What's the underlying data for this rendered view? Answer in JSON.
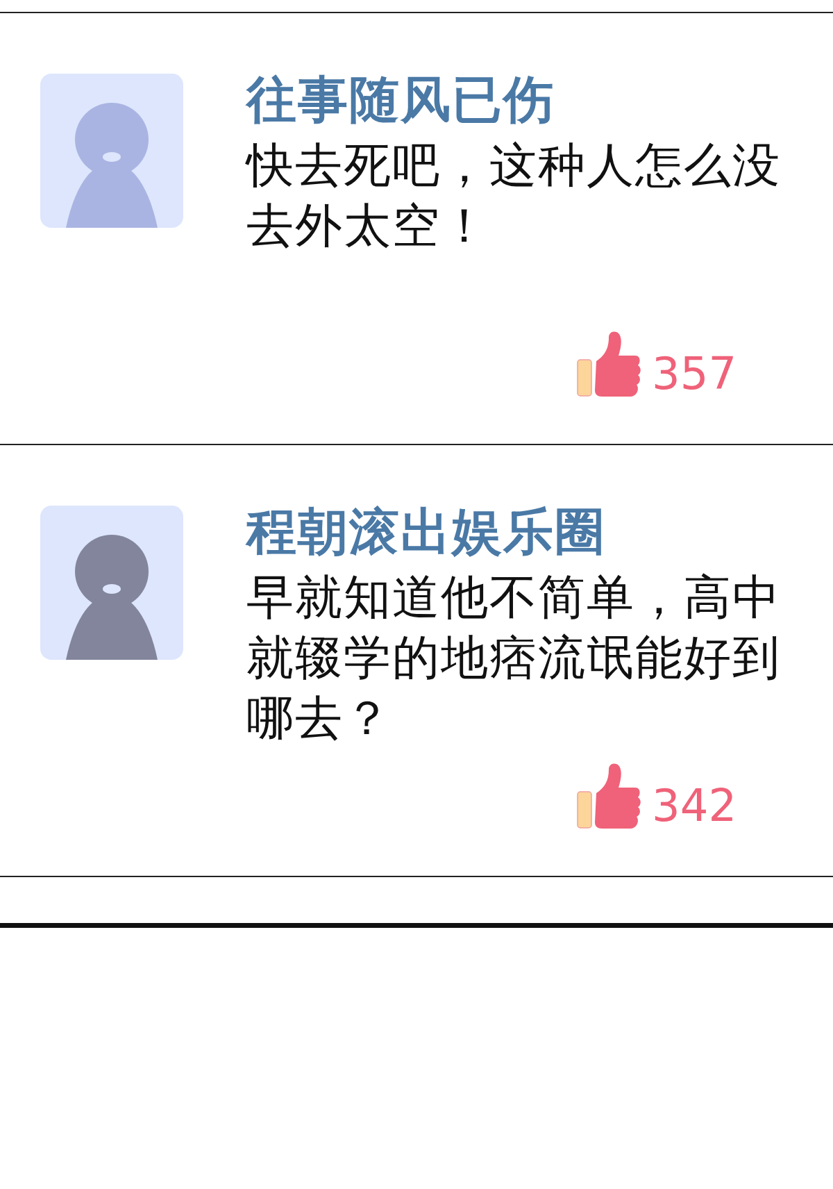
{
  "comments": [
    {
      "username": "往事随风已伤",
      "text": "快去死吧，这种人怎么没去外太空！",
      "likes": "357",
      "color": "#aab4e2"
    },
    {
      "username": "程朝滚出娱乐圈",
      "text": "早就知道他不简单，高中就辍学的地痞流氓能好到哪去？",
      "likes": "342",
      "color": "#82859b"
    }
  ]
}
